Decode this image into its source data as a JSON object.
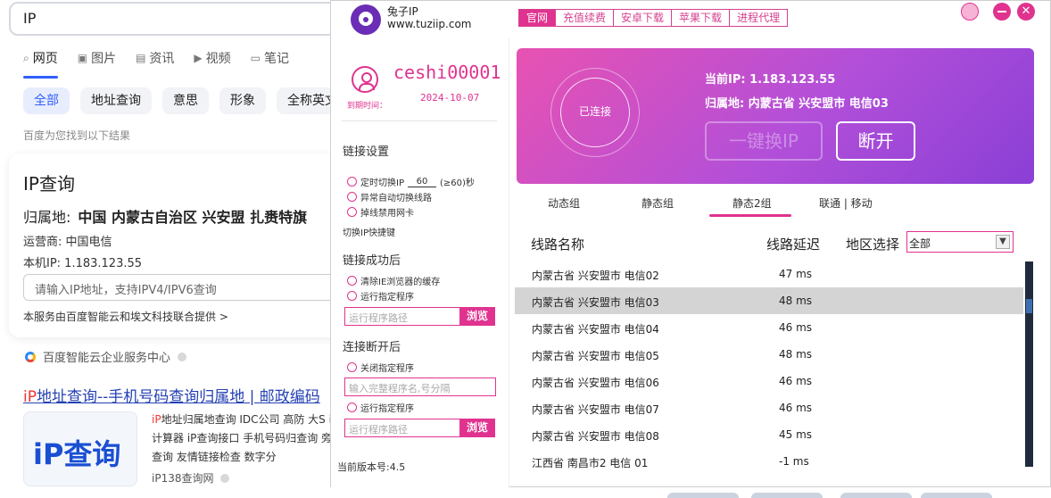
{
  "browser": {
    "search_query": "IP",
    "tabs": [
      {
        "icon": "search-icon",
        "label": "网页"
      },
      {
        "icon": "image-icon",
        "label": "图片"
      },
      {
        "icon": "news-icon",
        "label": "资讯"
      },
      {
        "icon": "video-icon",
        "label": "视频"
      },
      {
        "icon": "note-icon",
        "label": "笔记"
      }
    ],
    "chips": [
      "全部",
      "地址查询",
      "意思",
      "形象",
      "全称英文"
    ],
    "found_text": "百度为您找到以下结果",
    "ip_card": {
      "title": "IP查询",
      "location_label": "归属地:",
      "location_value": "中国 内蒙古自治区 兴安盟 扎赉特旗",
      "isp": "运营商: 中国电信",
      "my_ip": "本机IP: 1.183.123.55",
      "input_placeholder": "请输入IP地址，支持IPV4/IPV6查询",
      "service_note": "本服务由百度智能云和埃文科技联合提供 >"
    },
    "source_name": "百度智能云企业服务中心",
    "result": {
      "title_hl": "iP",
      "title_rest": "地址查询--手机号码查询归属地 | 邮政编码",
      "thumb_text": "iP查询",
      "desc_hl": "iP",
      "desc_rest": "地址归属地查询 IDC公司 高防 大S iP计算器 iP查询接口 手机号码归查询 旁站查询 友情链接检查 数字分",
      "site": "iP138查询网"
    }
  },
  "app": {
    "name": "兔子IP",
    "url": "www.tuziip.com",
    "nav": [
      "官网",
      "充值续费",
      "安卓下载",
      "苹果下载",
      "进程代理"
    ],
    "user": {
      "name": "ceshi00001",
      "expire_label": "到期时间：",
      "expire_date": "2024-10-07"
    },
    "link_settings": {
      "title": "链接设置",
      "timer_prefix": "定时切换IP",
      "timer_value": "60",
      "timer_suffix": "(≥60)秒",
      "auto_switch": "异常自动切换线路",
      "disable_nic": "掉线禁用网卡",
      "hotkey": "切换IP快捷键"
    },
    "after_success": {
      "title": "链接成功后",
      "clear_cache": "清除IE浏览器的缓存",
      "run_program": "运行指定程序",
      "path_placeholder": "运行程序路径",
      "browse": "浏览"
    },
    "after_disconnect": {
      "title": "连接断开后",
      "close_program": "关闭指定程序",
      "close_placeholder": "输入完整程序名,号分隔",
      "run_program": "运行指定程序",
      "path_placeholder": "运行程序路径",
      "browse": "浏览"
    },
    "version": "当前版本号:4.5",
    "status": {
      "state": "已连接",
      "current_ip": "当前IP: 1.183.123.55",
      "location": "归属地: 内蒙古省 兴安盟市 电信03",
      "switch_btn": "一键换IP",
      "disconnect_btn": "断开"
    },
    "groups": [
      "动态组",
      "静态组",
      "静态2组",
      "联通 | 移动"
    ],
    "active_group": "静态2组",
    "columns": {
      "name": "线路名称",
      "latency": "线路延迟",
      "region": "地区选择"
    },
    "region_value": "全部",
    "lines": [
      {
        "name": "内蒙古省 兴安盟市 电信02",
        "latency": "47 ms"
      },
      {
        "name": "内蒙古省 兴安盟市 电信03",
        "latency": "48 ms",
        "selected": true
      },
      {
        "name": "内蒙古省 兴安盟市 电信04",
        "latency": "46 ms"
      },
      {
        "name": "内蒙古省 兴安盟市 电信05",
        "latency": "48 ms"
      },
      {
        "name": "内蒙古省 兴安盟市 电信06",
        "latency": "46 ms"
      },
      {
        "name": "内蒙古省 兴安盟市 电信07",
        "latency": "46 ms"
      },
      {
        "name": "内蒙古省 兴安盟市 电信08",
        "latency": "45 ms"
      },
      {
        "name": "江西省 南昌市2 电信 01",
        "latency": "-1 ms"
      }
    ],
    "colors": {
      "accent": "#e0338f",
      "banner_start": "#e852b2",
      "banner_end": "#8a3fd6",
      "selected_row": "#d4d4d4"
    }
  }
}
